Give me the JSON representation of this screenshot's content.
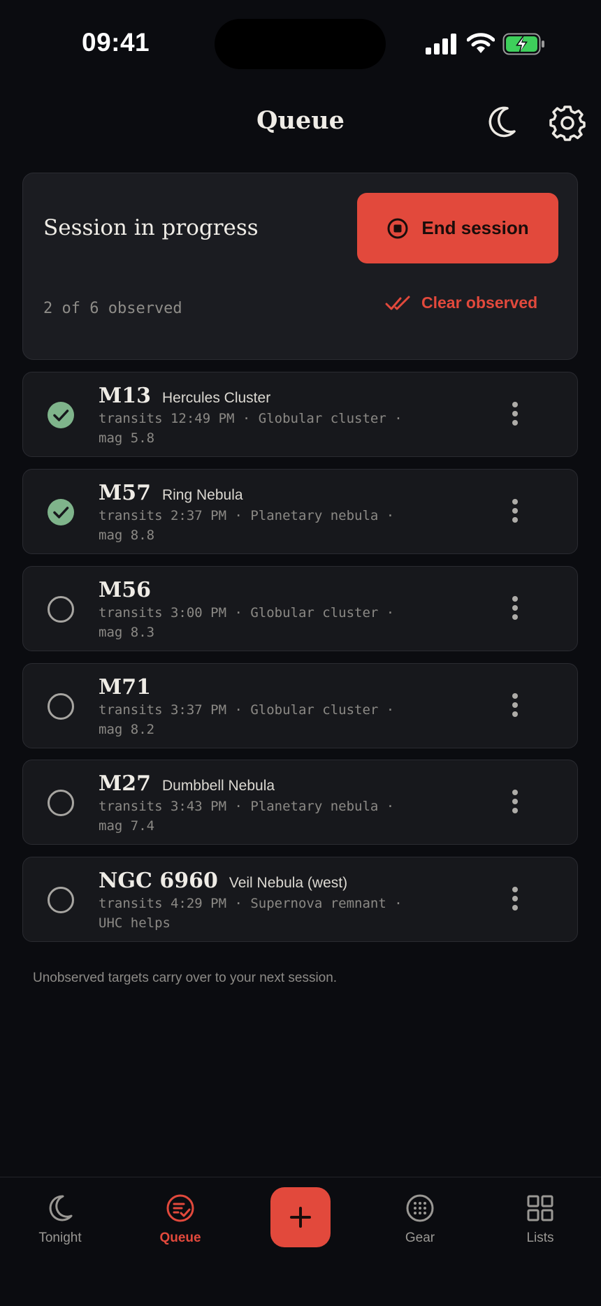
{
  "status_bar": {
    "time": "09:41"
  },
  "header": {
    "title": "Queue",
    "night_mode_icon": "moon-icon",
    "settings_icon": "gear-icon"
  },
  "session": {
    "title": "Session in progress",
    "end_label": "End session",
    "progress": "2 of 6 observed",
    "clear_label": "Clear observed"
  },
  "targets": [
    {
      "id": "M13",
      "common": "Hercules Cluster",
      "meta": "transits 12:49 PM  ·  Globular cluster ·",
      "meta2": "mag 5.8",
      "observed": true
    },
    {
      "id": "M57",
      "common": "Ring Nebula",
      "meta": "transits 2:37 PM  ·  Planetary nebula ·",
      "meta2": "mag 8.8",
      "observed": true
    },
    {
      "id": "M56",
      "common": "",
      "meta": "transits 3:00 PM  ·  Globular cluster ·",
      "meta2": "mag 8.3",
      "observed": false
    },
    {
      "id": "M71",
      "common": "",
      "meta": "transits 3:37 PM  ·  Globular cluster ·",
      "meta2": "mag 8.2",
      "observed": false
    },
    {
      "id": "M27",
      "common": "Dumbbell Nebula",
      "meta": "transits 3:43 PM  ·  Planetary nebula ·",
      "meta2": "mag 7.4",
      "observed": false
    },
    {
      "id": "NGC 6960",
      "common": "Veil Nebula (west)",
      "meta": "transits 4:29 PM  ·  Supernova remnant ·",
      "meta2": "UHC helps",
      "observed": false
    }
  ],
  "footnote": "Unobserved targets carry over to your next session.",
  "tabs": [
    {
      "label": "Tonight",
      "icon": "moon-icon",
      "active": false
    },
    {
      "label": "Queue",
      "icon": "queue-icon",
      "active": true
    },
    {
      "label": "Gear",
      "icon": "gear-reticle-icon",
      "active": false
    },
    {
      "label": "Lists",
      "icon": "grid-icon",
      "active": false
    }
  ],
  "add_button_icon": "plus-icon",
  "colors": {
    "accent": "#e2493c",
    "observed": "#7fb48b",
    "background": "#0b0c10",
    "card": "#1b1c21"
  }
}
